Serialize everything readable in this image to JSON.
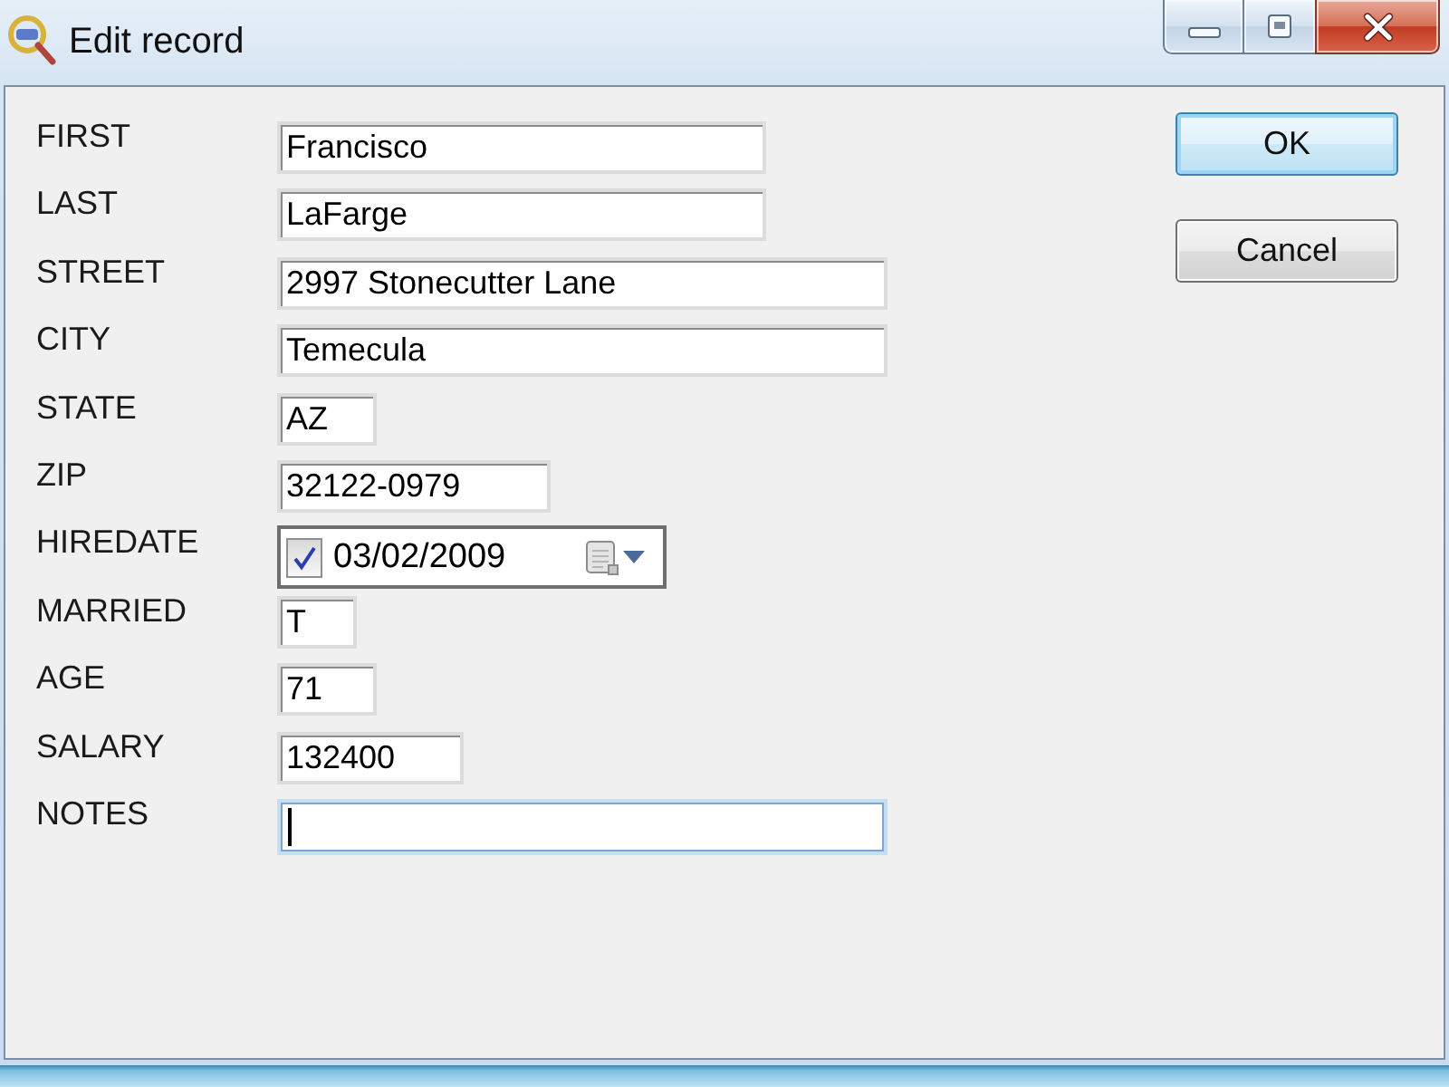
{
  "window": {
    "title": "Edit record"
  },
  "fields": [
    {
      "label": "FIRST",
      "kind": "text",
      "value": "Francisco",
      "focused": false
    },
    {
      "label": "LAST",
      "kind": "text",
      "value": "LaFarge",
      "focused": false
    },
    {
      "label": "STREET",
      "kind": "text",
      "value": "2997 Stonecutter Lane",
      "focused": false
    },
    {
      "label": "CITY",
      "kind": "text",
      "value": "Temecula",
      "focused": false
    },
    {
      "label": "STATE",
      "kind": "text",
      "value": "AZ",
      "focused": false
    },
    {
      "label": "ZIP",
      "kind": "text",
      "value": "32122-0979",
      "focused": false
    },
    {
      "label": "HIREDATE",
      "kind": "date",
      "checked": true,
      "value": "03/02/2009",
      "focused": false
    },
    {
      "label": "MARRIED",
      "kind": "text",
      "value": "T",
      "focused": false
    },
    {
      "label": "AGE",
      "kind": "text",
      "value": "71",
      "focused": false
    },
    {
      "label": "SALARY",
      "kind": "text",
      "value": "132400",
      "focused": false
    },
    {
      "label": "NOTES",
      "kind": "text",
      "focused": true
    }
  ],
  "buttons": [
    {
      "label": "OK",
      "default": true
    },
    {
      "label": "Cancel",
      "default": false
    }
  ]
}
